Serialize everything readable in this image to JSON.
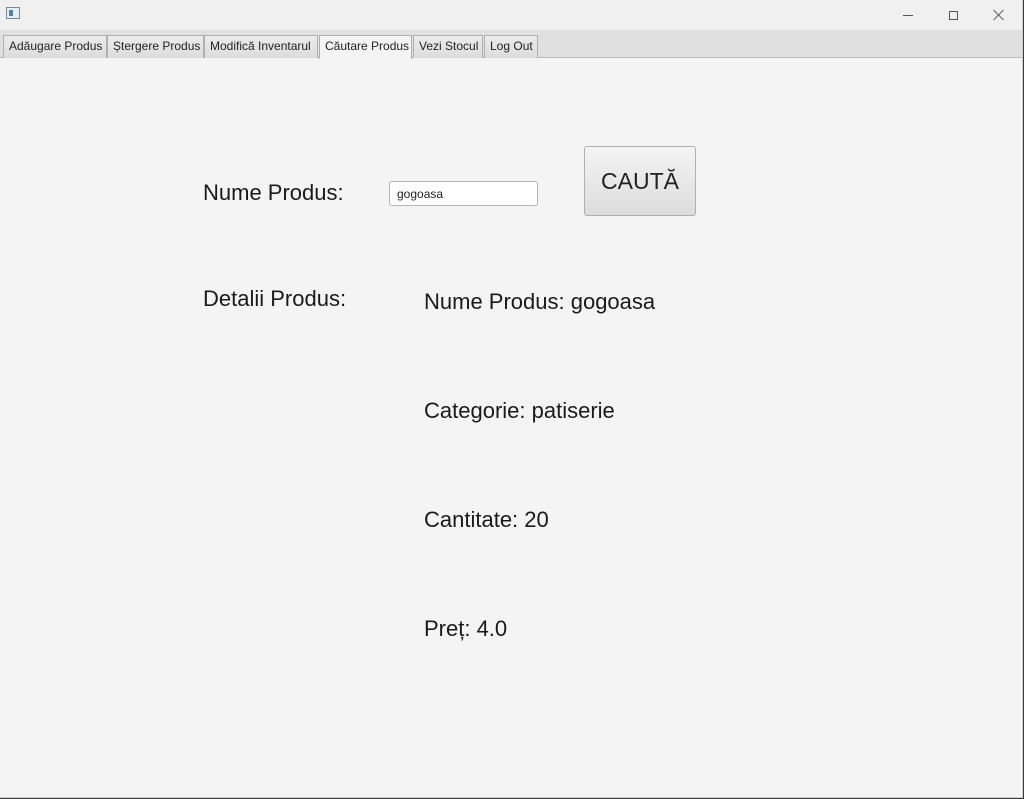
{
  "tabs": [
    {
      "label": "Adăugare Produs"
    },
    {
      "label": "Ștergere Produs"
    },
    {
      "label": "Modifică Inventarul"
    },
    {
      "label": "Căutare Produs"
    },
    {
      "label": "Vezi Stocul"
    },
    {
      "label": "Log Out"
    }
  ],
  "active_tab": "Căutare Produs",
  "search": {
    "label": "Nume Produs:",
    "value": "gogoasa",
    "button_label": "CAUTĂ"
  },
  "details": {
    "label": "Detalii Produs:",
    "name": "Nume Produs: gogoasa",
    "category": "Categorie: patiserie",
    "quantity": "Cantitate: 20",
    "price": "Preț: 4.0"
  },
  "icons": {
    "app": "app-window-icon",
    "minimize": "minimize-icon",
    "maximize": "maximize-icon",
    "close": "close-icon"
  }
}
